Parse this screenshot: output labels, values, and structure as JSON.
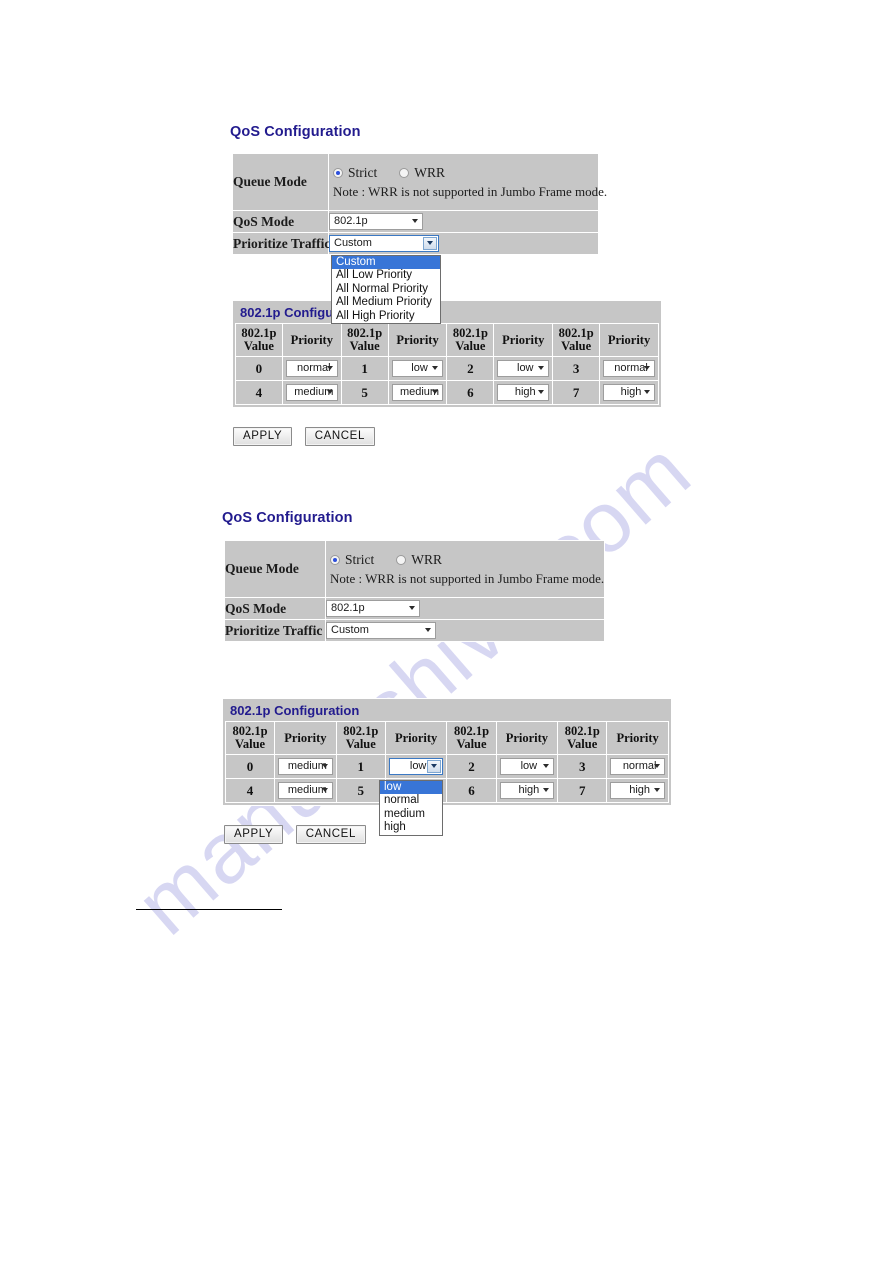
{
  "watermark": {
    "text": "manualshive.com"
  },
  "sections": [
    {
      "id": "top",
      "heading": "QoS Configuration",
      "qos_form": {
        "rows": [
          {
            "label": "Queue Mode"
          },
          {
            "label": "QoS Mode"
          },
          {
            "label": "Prioritize Traffic"
          }
        ],
        "queue_mode": {
          "options": [
            {
              "label": "Strict",
              "selected": true
            },
            {
              "label": "WRR",
              "selected": false
            }
          ],
          "note": "Note : WRR is not supported in Jumbo Frame mode."
        },
        "qos_mode": {
          "value": "802.1p",
          "open": false
        },
        "prioritize_traffic": {
          "value": "Custom",
          "open": true,
          "options": [
            "Custom",
            "All Low Priority",
            "All Normal Priority",
            "All Medium Priority",
            "All High Priority"
          ],
          "selected_index": 0
        }
      },
      "p8021": {
        "title": "802.1p Configuration",
        "headers": [
          "802.1p Value",
          "Priority",
          "802.1p Value",
          "Priority",
          "802.1p Value",
          "Priority",
          "802.1p Value",
          "Priority"
        ],
        "header_line1": "802.1p",
        "header_line2": "Value",
        "header_priority": "Priority",
        "rows": [
          [
            {
              "value": "0",
              "priority": "normal"
            },
            {
              "value": "1",
              "priority": "low"
            },
            {
              "value": "2",
              "priority": "low"
            },
            {
              "value": "3",
              "priority": "normal"
            }
          ],
          [
            {
              "value": "4",
              "priority": "medium"
            },
            {
              "value": "5",
              "priority": "medium"
            },
            {
              "value": "6",
              "priority": "high"
            },
            {
              "value": "7",
              "priority": "high"
            }
          ]
        ]
      },
      "buttons": {
        "apply": "APPLY",
        "cancel": "CANCEL"
      }
    },
    {
      "id": "bottom",
      "heading": "QoS Configuration",
      "qos_form": {
        "rows": [
          {
            "label": "Queue Mode"
          },
          {
            "label": "QoS Mode"
          },
          {
            "label": "Prioritize Traffic"
          }
        ],
        "queue_mode": {
          "options": [
            {
              "label": "Strict",
              "selected": true
            },
            {
              "label": "WRR",
              "selected": false
            }
          ],
          "note": "Note : WRR is not supported in Jumbo Frame mode."
        },
        "qos_mode": {
          "value": "802.1p",
          "open": false
        },
        "prioritize_traffic": {
          "value": "Custom",
          "open": false,
          "options": [],
          "selected_index": 0
        }
      },
      "p8021": {
        "title": "802.1p Configuration",
        "header_line1": "802.1p",
        "header_line2": "Value",
        "header_priority": "Priority",
        "rows": [
          [
            {
              "value": "0",
              "priority": "medium"
            },
            {
              "value": "1",
              "priority": "low",
              "open": true
            },
            {
              "value": "2",
              "priority": "low"
            },
            {
              "value": "3",
              "priority": "normal"
            }
          ],
          [
            {
              "value": "4",
              "priority": "medium"
            },
            {
              "value": "5",
              "priority": ""
            },
            {
              "value": "6",
              "priority": "high"
            },
            {
              "value": "7",
              "priority": "high"
            }
          ]
        ],
        "open_dropdown": {
          "options": [
            "low",
            "normal",
            "medium",
            "high"
          ],
          "selected_index": 0
        }
      },
      "buttons": {
        "apply": "APPLY",
        "cancel": "CANCEL"
      }
    }
  ]
}
